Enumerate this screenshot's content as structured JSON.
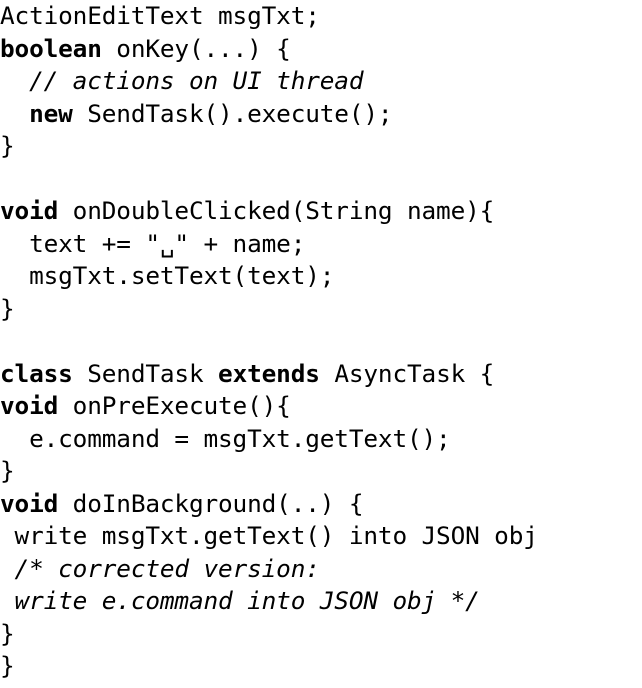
{
  "listing": {
    "language": "java",
    "background_color": "#ffffff",
    "text_color": "#000000",
    "lines": [
      {
        "id": "line-1",
        "indent": "",
        "tokens": [
          {
            "kind": "plain",
            "text": "ActionEditText msgTxt;"
          }
        ]
      },
      {
        "id": "line-2",
        "indent": "",
        "tokens": [
          {
            "kind": "keyword",
            "text": "boolean"
          },
          {
            "kind": "plain",
            "text": " onKey(...) {"
          }
        ]
      },
      {
        "id": "line-3",
        "indent": "  ",
        "tokens": [
          {
            "kind": "comment",
            "text": "// actions on UI thread"
          }
        ]
      },
      {
        "id": "line-4",
        "indent": "  ",
        "tokens": [
          {
            "kind": "keyword",
            "text": "new"
          },
          {
            "kind": "plain",
            "text": " SendTask().execute();"
          }
        ]
      },
      {
        "id": "line-5",
        "indent": "",
        "tokens": [
          {
            "kind": "plain",
            "text": "}"
          }
        ]
      },
      {
        "id": "line-6",
        "indent": "",
        "tokens": [
          {
            "kind": "plain",
            "text": ""
          }
        ]
      },
      {
        "id": "line-7",
        "indent": "",
        "tokens": [
          {
            "kind": "keyword",
            "text": "void"
          },
          {
            "kind": "plain",
            "text": " onDoubleClicked(String name){"
          }
        ]
      },
      {
        "id": "line-8",
        "indent": "  ",
        "tokens": [
          {
            "kind": "plain",
            "text": "text += \"␣\" + name;"
          }
        ]
      },
      {
        "id": "line-9",
        "indent": "  ",
        "tokens": [
          {
            "kind": "plain",
            "text": "msgTxt.setText(text);"
          }
        ]
      },
      {
        "id": "line-10",
        "indent": "",
        "tokens": [
          {
            "kind": "plain",
            "text": "}"
          }
        ]
      },
      {
        "id": "line-11",
        "indent": "",
        "tokens": [
          {
            "kind": "plain",
            "text": ""
          }
        ]
      },
      {
        "id": "line-12",
        "indent": "",
        "tokens": [
          {
            "kind": "keyword",
            "text": "class"
          },
          {
            "kind": "plain",
            "text": " SendTask "
          },
          {
            "kind": "keyword",
            "text": "extends"
          },
          {
            "kind": "plain",
            "text": " AsyncTask {"
          }
        ]
      },
      {
        "id": "line-13",
        "indent": "",
        "tokens": [
          {
            "kind": "keyword",
            "text": "void"
          },
          {
            "kind": "plain",
            "text": " onPreExecute(){"
          }
        ]
      },
      {
        "id": "line-14",
        "indent": "  ",
        "tokens": [
          {
            "kind": "plain",
            "text": "e.command = msgTxt.getText();"
          }
        ]
      },
      {
        "id": "line-15",
        "indent": "",
        "tokens": [
          {
            "kind": "plain",
            "text": "}"
          }
        ]
      },
      {
        "id": "line-16",
        "indent": "",
        "tokens": [
          {
            "kind": "keyword",
            "text": "void"
          },
          {
            "kind": "plain",
            "text": " doInBackground(..) {"
          }
        ]
      },
      {
        "id": "line-17",
        "indent": " ",
        "tokens": [
          {
            "kind": "plain",
            "text": "write msgTxt.getText() into JSON obj"
          }
        ]
      },
      {
        "id": "line-18",
        "indent": " ",
        "tokens": [
          {
            "kind": "comment",
            "text": "/* corrected version:"
          }
        ]
      },
      {
        "id": "line-19",
        "indent": " ",
        "tokens": [
          {
            "kind": "comment",
            "text": "write e.command into JSON obj */"
          }
        ]
      },
      {
        "id": "line-20",
        "indent": "",
        "tokens": [
          {
            "kind": "plain",
            "text": "}"
          }
        ]
      },
      {
        "id": "line-21",
        "indent": "",
        "tokens": [
          {
            "kind": "plain",
            "text": "}"
          }
        ]
      }
    ]
  }
}
